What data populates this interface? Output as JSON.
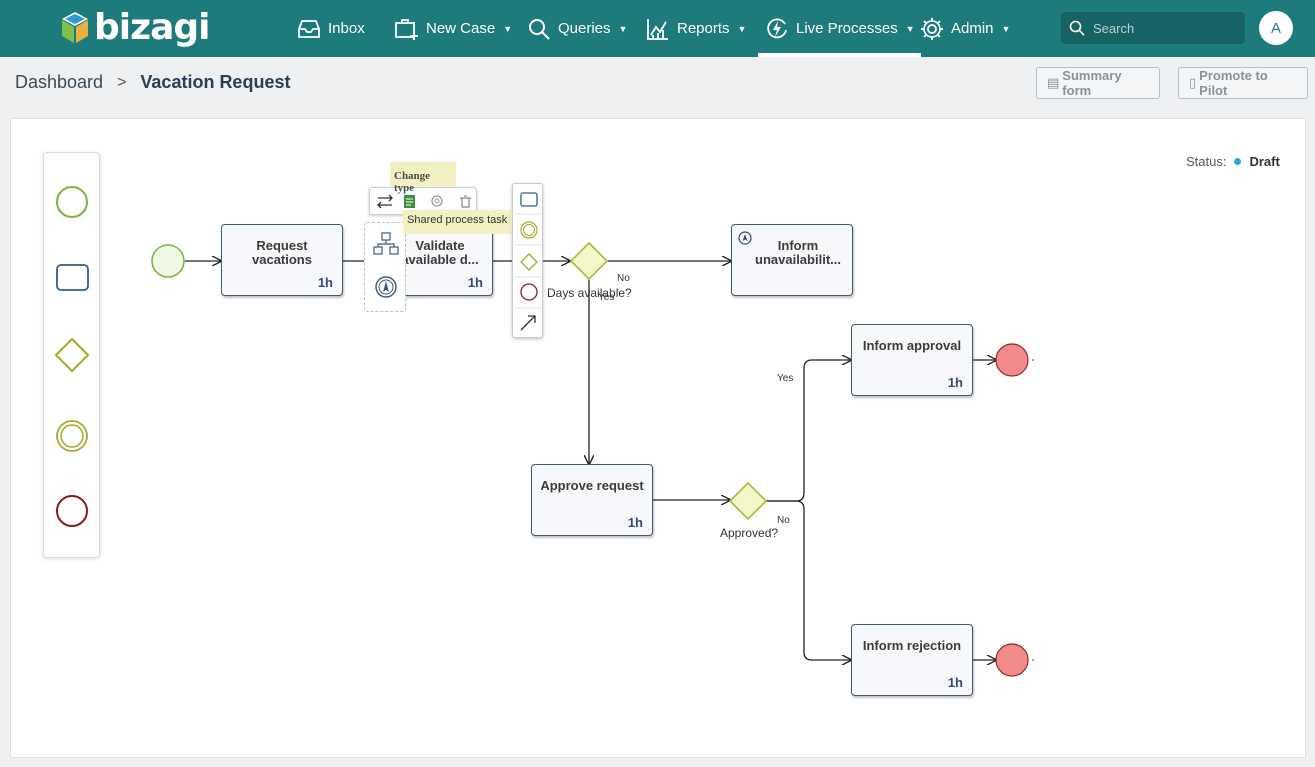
{
  "brand": {
    "name": "bizagi"
  },
  "nav": {
    "inbox": "Inbox",
    "new_case": "New Case",
    "queries": "Queries",
    "reports": "Reports",
    "live_processes": "Live Processes",
    "admin": "Admin",
    "search_placeholder": "Search",
    "avatar_initial": "A"
  },
  "breadcrumb": {
    "root": "Dashboard",
    "current": "Vacation Request"
  },
  "actions": {
    "summary_form": "Summary form",
    "promote": "Promote to Pilot"
  },
  "status": {
    "label": "Status:",
    "value": "Draft",
    "color": "#29a8d8"
  },
  "tooltips": {
    "change_type": "Change type",
    "shared_task": "Shared process task"
  },
  "diagram": {
    "tasks": {
      "request": {
        "label": "Request vacations",
        "duration": "1h"
      },
      "validate": {
        "label": "Validate available d...",
        "duration": "1h"
      },
      "inform_unavail": {
        "label": "Inform unavailabilit..."
      },
      "approve": {
        "label": "Approve request",
        "duration": "1h"
      },
      "inform_approval": {
        "label": "Inform approval",
        "duration": "1h"
      },
      "inform_rejection": {
        "label": "Inform rejection",
        "duration": "1h"
      }
    },
    "gateways": {
      "days": "Days available?",
      "approved": "Approved?"
    },
    "edges": {
      "no1": "No",
      "yes1": "Yes",
      "yes2": "Yes",
      "no2": "No"
    }
  },
  "colors": {
    "topbar": "#1e7b7b",
    "start": "#7cb342",
    "end": "#e57373",
    "gateway": "#a8b83a",
    "task_border": "#3b5a78"
  }
}
